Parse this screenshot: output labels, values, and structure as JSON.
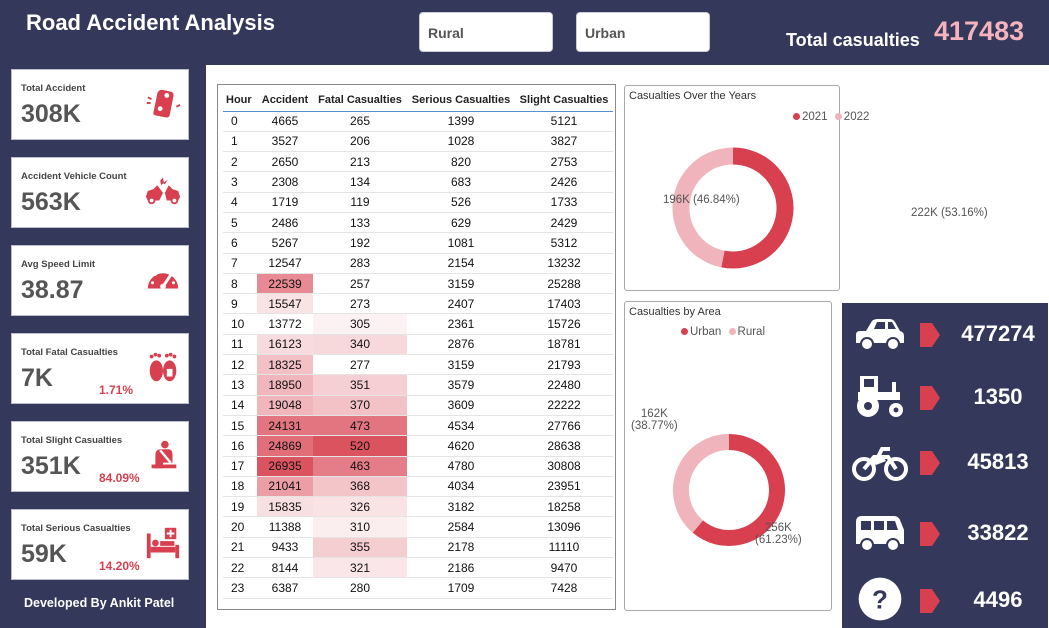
{
  "header": {
    "title": "Road Accident Analysis",
    "slicers": [
      "Rural",
      "Urban"
    ],
    "total_label": "Total casualties",
    "total_value": "417483"
  },
  "kpis": [
    {
      "label": "Total Accident",
      "value": "308K",
      "pct": "",
      "icon": "car-crash-icon"
    },
    {
      "label": "Accident Vehicle Count",
      "value": "563K",
      "pct": "",
      "icon": "collision-icon"
    },
    {
      "label": "Avg Speed Limit",
      "value": "38.87",
      "pct": "",
      "icon": "speedometer-icon"
    },
    {
      "label": "Total Fatal Casualties",
      "value": "7K",
      "pct": "1.71%",
      "icon": "footprints-icon"
    },
    {
      "label": "Total Slight Casualties",
      "value": "351K",
      "pct": "84.09%",
      "icon": "seatbelt-icon"
    },
    {
      "label": "Total Serious Casualties",
      "value": "59K",
      "pct": "14.20%",
      "icon": "hospital-bed-icon"
    }
  ],
  "footer": {
    "developer": "Developed By Ankit Patel"
  },
  "table": {
    "columns": [
      "Hour",
      "Accident",
      "Fatal Casualties",
      "Serious Casualties",
      "Slight Casualties"
    ],
    "rows": [
      [
        "0",
        "4665",
        "265",
        "1399",
        "5121"
      ],
      [
        "1",
        "3527",
        "206",
        "1028",
        "3827"
      ],
      [
        "2",
        "2650",
        "213",
        "820",
        "2753"
      ],
      [
        "3",
        "2308",
        "134",
        "683",
        "2426"
      ],
      [
        "4",
        "1719",
        "119",
        "526",
        "1733"
      ],
      [
        "5",
        "2486",
        "133",
        "629",
        "2429"
      ],
      [
        "6",
        "5267",
        "192",
        "1081",
        "5312"
      ],
      [
        "7",
        "12547",
        "283",
        "2154",
        "13232"
      ],
      [
        "8",
        "22539",
        "257",
        "3159",
        "25288"
      ],
      [
        "9",
        "15547",
        "273",
        "2407",
        "17403"
      ],
      [
        "10",
        "13772",
        "305",
        "2361",
        "15726"
      ],
      [
        "11",
        "16123",
        "340",
        "2876",
        "18781"
      ],
      [
        "12",
        "18325",
        "277",
        "3159",
        "21793"
      ],
      [
        "13",
        "18950",
        "351",
        "3579",
        "22480"
      ],
      [
        "14",
        "19048",
        "370",
        "3609",
        "22222"
      ],
      [
        "15",
        "24131",
        "473",
        "4534",
        "27766"
      ],
      [
        "16",
        "24869",
        "520",
        "4620",
        "28638"
      ],
      [
        "17",
        "26935",
        "463",
        "4780",
        "30808"
      ],
      [
        "18",
        "21041",
        "368",
        "4034",
        "23951"
      ],
      [
        "19",
        "15835",
        "326",
        "3182",
        "18258"
      ],
      [
        "20",
        "11388",
        "310",
        "2584",
        "13096"
      ],
      [
        "21",
        "9433",
        "355",
        "2178",
        "11110"
      ],
      [
        "22",
        "8144",
        "321",
        "2186",
        "9470"
      ],
      [
        "23",
        "6387",
        "280",
        "1709",
        "7428"
      ]
    ],
    "heat_color": "#d8404f"
  },
  "years_chart": {
    "title": "Casualties Over the Years",
    "legend": [
      {
        "name": "2021",
        "color": "#d8404f"
      },
      {
        "name": "2022",
        "color": "#f0b5bc"
      }
    ],
    "slices": [
      {
        "name": "2021",
        "value": 222,
        "label": "222K (53.16%)",
        "color": "#d8404f"
      },
      {
        "name": "2022",
        "value": 196,
        "label": "196K (46.84%)",
        "color": "#f0b5bc"
      }
    ]
  },
  "area_chart": {
    "title": "Casualties by Area",
    "legend": [
      {
        "name": "Urban",
        "color": "#d8404f"
      },
      {
        "name": "Rural",
        "color": "#f0b5bc"
      }
    ],
    "slices": [
      {
        "name": "Urban",
        "value": 256,
        "label_line1": "256K",
        "label_line2": "(61.23%)",
        "color": "#d8404f"
      },
      {
        "name": "Rural",
        "value": 162,
        "label_line1": "162K",
        "label_line2": "(38.77%)",
        "color": "#f0b5bc"
      }
    ]
  },
  "vehicles": [
    {
      "icon": "car-icon",
      "value": "477274"
    },
    {
      "icon": "tractor-icon",
      "value": "1350"
    },
    {
      "icon": "motorcycle-icon",
      "value": "45813"
    },
    {
      "icon": "van-icon",
      "value": "33822"
    },
    {
      "icon": "question-icon",
      "value": "4496"
    }
  ],
  "colors": {
    "background": "#34385a",
    "accent": "#d8404f",
    "accent_light": "#f0b5bc",
    "total_value": "#f4b3bd"
  }
}
